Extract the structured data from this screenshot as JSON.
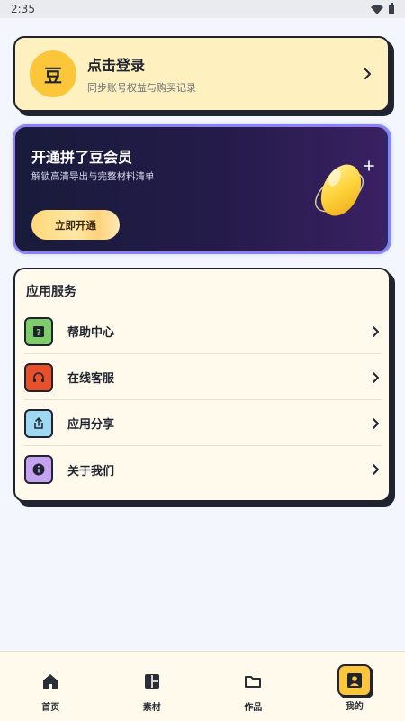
{
  "status_bar": {
    "time": "2:35"
  },
  "login": {
    "avatar_text": "豆",
    "title": "点击登录",
    "subtitle": "同步账号权益与购买记录"
  },
  "vip": {
    "title": "开通拼了豆会员",
    "subtitle": "解锁高清导出与完整材料清单",
    "button_label": "立即开通"
  },
  "services": {
    "title": "应用服务",
    "items": [
      {
        "label": "帮助中心",
        "icon": "help-icon",
        "color": "#7fcd6a"
      },
      {
        "label": "在线客服",
        "icon": "headset-icon",
        "color": "#e8502a"
      },
      {
        "label": "应用分享",
        "icon": "share-icon",
        "color": "#9fd8f2"
      },
      {
        "label": "关于我们",
        "icon": "info-icon",
        "color": "#c5a3f2"
      }
    ]
  },
  "tabs": [
    {
      "label": "首页",
      "icon": "home-icon"
    },
    {
      "label": "素材",
      "icon": "materials-icon"
    },
    {
      "label": "作品",
      "icon": "folder-icon"
    },
    {
      "label": "我的",
      "icon": "user-icon",
      "active": true
    }
  ],
  "colors": {
    "accent": "#fbc63a",
    "ink": "#1f2430",
    "card_cream": "#fffaeb",
    "login_bg": "#fff0bf"
  }
}
